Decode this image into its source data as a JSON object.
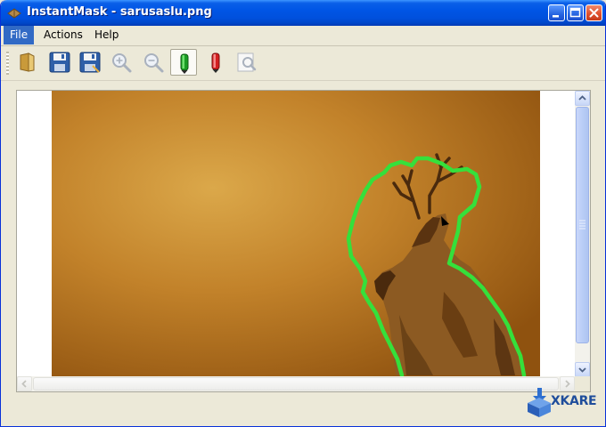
{
  "window": {
    "title": "InstantMask - sarusaslu.png"
  },
  "title_buttons": [
    "minimize",
    "maximize",
    "close"
  ],
  "menu": {
    "items": [
      {
        "label": "File",
        "active": true
      },
      {
        "label": "Actions",
        "active": false
      },
      {
        "label": "Help",
        "active": false
      }
    ]
  },
  "toolbar": {
    "tools": [
      {
        "icon": "open-folder-icon",
        "pressed": false
      },
      {
        "icon": "save-icon",
        "pressed": false
      },
      {
        "icon": "save-as-icon",
        "pressed": false
      },
      {
        "icon": "zoom-in-icon",
        "pressed": false
      },
      {
        "icon": "zoom-out-icon",
        "pressed": false
      },
      {
        "icon": "green-marker-icon",
        "pressed": true
      },
      {
        "icon": "red-marker-icon",
        "pressed": false
      },
      {
        "icon": "preview-icon",
        "pressed": false
      }
    ]
  },
  "canvas": {
    "background_color": "#b06f18",
    "mask_outline_color": "#35e03b"
  },
  "watermark": {
    "text": "XKARE"
  }
}
